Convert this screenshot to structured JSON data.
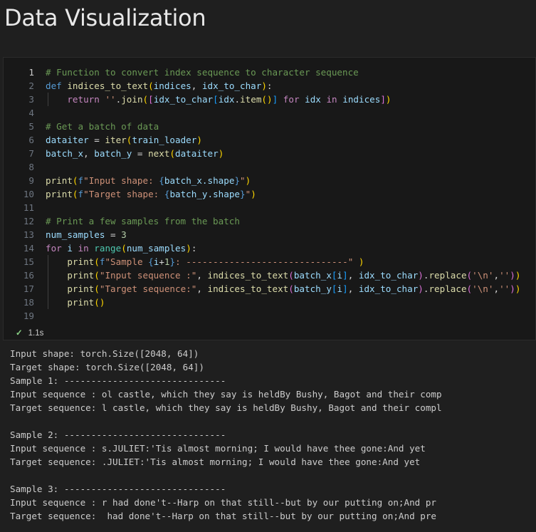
{
  "page": {
    "title": "Data Visualization"
  },
  "cell": {
    "lines": [
      "1",
      "2",
      "3",
      "4",
      "5",
      "6",
      "7",
      "8",
      "9",
      "10",
      "11",
      "12",
      "13",
      "14",
      "15",
      "16",
      "17",
      "18",
      "19"
    ],
    "tokens": {
      "l1_comment": "# Function to convert index sequence to character sequence",
      "l2_def": "def",
      "l2_name": "indices_to_text",
      "l2_p1": "indices",
      "l2_p2": "idx_to_char",
      "l3_return": "return",
      "l3_str": "''",
      "l3_join": "join",
      "l3_arr": "idx_to_char",
      "l3_idx": "idx",
      "l3_item": "item",
      "l3_for": "for",
      "l3_idx2": "idx",
      "l3_in": "in",
      "l3_indices": "indices",
      "l5_comment": "# Get a batch of data",
      "l6_var": "dataiter",
      "l6_iter": "iter",
      "l6_arg": "train_loader",
      "l7_v1": "batch_x",
      "l7_v2": "batch_y",
      "l7_next": "next",
      "l7_arg": "dataiter",
      "l9_print": "print",
      "l9_f": "f",
      "l9_s1": "\"Input shape: ",
      "l9_expr": "batch_x.shape",
      "l9_s2": "\"",
      "l10_print": "print",
      "l10_f": "f",
      "l10_s1": "\"Target shape: ",
      "l10_expr": "batch_y.shape",
      "l10_s2": "\"",
      "l12_comment": "# Print a few samples from the batch",
      "l13_var": "num_samples",
      "l13_num": "3",
      "l14_for": "for",
      "l14_i": "i",
      "l14_in": "in",
      "l14_range": "range",
      "l14_arg": "num_samples",
      "l15_print": "print",
      "l15_f": "f",
      "l15_s1": "\"Sample ",
      "l15_expr": "i",
      "l15_num": "1",
      "l15_s2": ": ------------------------------\"",
      "l16_print": "print",
      "l16_str": "\"Input sequence :\"",
      "l16_fn": "indices_to_text",
      "l16_a1": "batch_x",
      "l16_a2": "i",
      "l16_a3": "idx_to_char",
      "l16_rep": "replace",
      "l16_s1": "'\\n'",
      "l16_s2": "''",
      "l17_print": "print",
      "l17_str": "\"Target sequence:\"",
      "l17_fn": "indices_to_text",
      "l17_a1": "batch_y",
      "l17_a2": "i",
      "l17_a3": "idx_to_char",
      "l17_rep": "replace",
      "l17_s1": "'\\n'",
      "l17_s2": "''",
      "l18_print": "print"
    },
    "status": {
      "time": "1.1s"
    }
  },
  "output": {
    "lines": [
      "Input shape: torch.Size([2048, 64])",
      "Target shape: torch.Size([2048, 64])",
      "Sample 1: ------------------------------",
      "Input sequence : ol castle, which they say is heldBy Bushy, Bagot and their comp",
      "Target sequence: l castle, which they say is heldBy Bushy, Bagot and their compl",
      "",
      "Sample 2: ------------------------------",
      "Input sequence : s.JULIET:'Tis almost morning; I would have thee gone:And yet",
      "Target sequence: .JULIET:'Tis almost morning; I would have thee gone:And yet",
      "",
      "Sample 3: ------------------------------",
      "Input sequence : r had done't--Harp on that still--but by our putting on;And pr",
      "Target sequence:  had done't--Harp on that still--but by our putting on;And pre"
    ]
  }
}
